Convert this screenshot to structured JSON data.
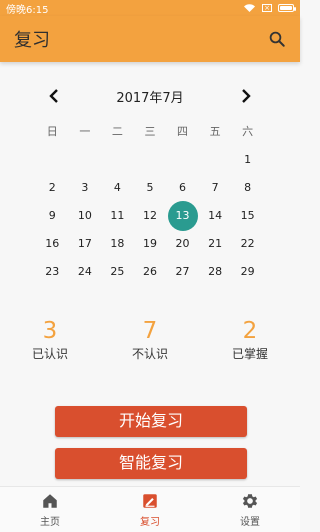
{
  "status_bar": {
    "time": "傍晚6:15"
  },
  "app_bar": {
    "title": "复习"
  },
  "calendar": {
    "month_title": "2017年7月",
    "weekdays": [
      "日",
      "一",
      "二",
      "三",
      "四",
      "五",
      "六"
    ],
    "days": [
      "",
      "",
      "",
      "",
      "",
      "",
      "1",
      "2",
      "3",
      "4",
      "5",
      "6",
      "7",
      "8",
      "9",
      "10",
      "11",
      "12",
      "13",
      "14",
      "15",
      "16",
      "17",
      "18",
      "19",
      "20",
      "21",
      "22",
      "23",
      "24",
      "25",
      "26",
      "27",
      "28",
      "29"
    ],
    "selected_day": "13"
  },
  "stats": [
    {
      "value": "3",
      "label": "已认识"
    },
    {
      "value": "7",
      "label": "不认识"
    },
    {
      "value": "2",
      "label": "已掌握"
    }
  ],
  "buttons": {
    "start_review": "开始复习",
    "smart_review": "智能复习"
  },
  "bottom_nav": {
    "items": [
      {
        "label": "主页",
        "icon": "home-icon"
      },
      {
        "label": "复习",
        "icon": "review-icon"
      },
      {
        "label": "设置",
        "icon": "settings-icon"
      }
    ],
    "active": "复习"
  },
  "colors": {
    "accent": "#f3a23f",
    "primary_button": "#d94f2e",
    "selected_day": "#2a9b90"
  }
}
